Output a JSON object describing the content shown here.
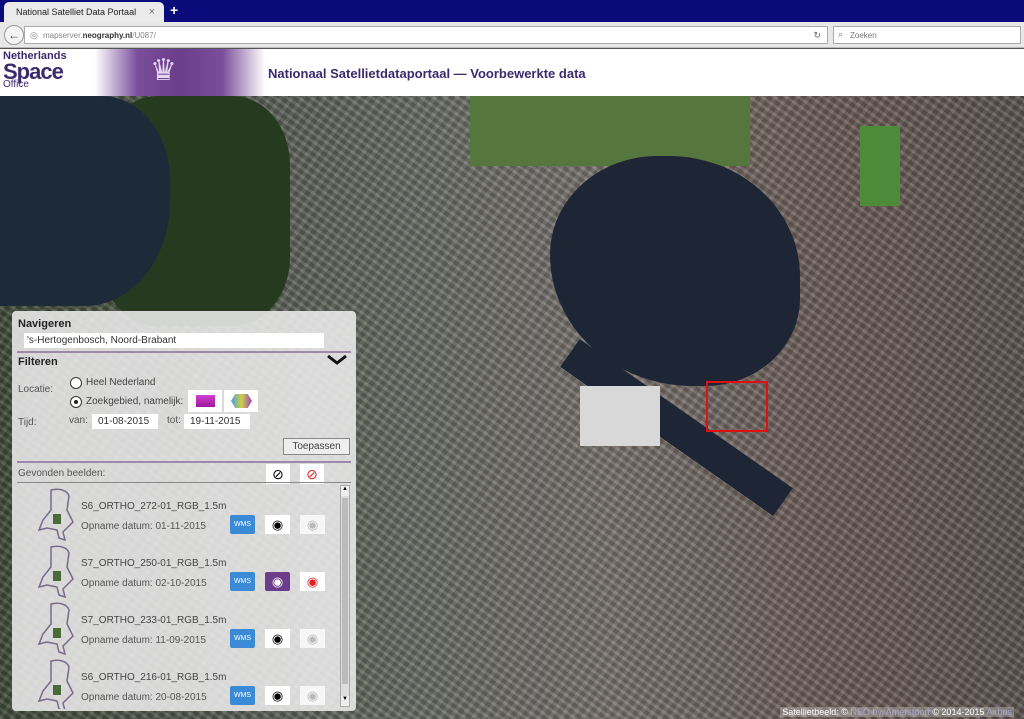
{
  "browser": {
    "tab_title": "National Satelliet Data Portaal",
    "tab_close": "×",
    "new_tab": "+",
    "url_prefix": "mapserver.",
    "url_domain": "neography.nl",
    "url_path": "/U087/",
    "search_placeholder": "Zoeken",
    "back": "←",
    "reload": "↻"
  },
  "header": {
    "logo_line1": "Netherlands",
    "logo_line2": "Space",
    "logo_line3": "Office",
    "crest": "♛",
    "title": "Nationaal Satellietdataportaal — Voorbewerkte data"
  },
  "map": {
    "attribution": "Satellietbeeld: ©",
    "attribution_link": "NEO bv, Amersfoort",
    "attribution_year": "© 2014-2015",
    "attribution_link2": "Airbus"
  },
  "panel": {
    "navigate_heading": "Navigeren",
    "navigate_value": "'s-Hertogenbosch, Noord-Brabant",
    "filter_heading": "Filteren",
    "location_label": "Locatie:",
    "option_all": "Heel Nederland",
    "option_area": "Zoekgebied, namelijk:",
    "selected_option": "Zoekgebied, namelijk:",
    "time_label": "Tijd:",
    "from_label": "van:",
    "from_value": "01-08-2015",
    "to_label": "tot:",
    "to_value": "19-11-2015",
    "apply_button": "Toepassen",
    "found_label": "Gevonden beelden:",
    "results": [
      {
        "name": "S6_ORTHO_272-01_RGB_1.5m",
        "date": "Opname datum: 01-11-2015",
        "wms": "WMS",
        "visible": false,
        "compare": false
      },
      {
        "name": "S7_ORTHO_250-01_RGB_1.5m",
        "date": "Opname datum: 02-10-2015",
        "wms": "WMS",
        "visible": true,
        "compare": true
      },
      {
        "name": "S7_ORTHO_233-01_RGB_1.5m",
        "date": "Opname datum: 11-09-2015",
        "wms": "WMS",
        "visible": false,
        "compare": false
      },
      {
        "name": "S6_ORTHO_216-01_RGB_1.5m",
        "date": "Opname datum: 20-08-2015",
        "wms": "WMS",
        "visible": false,
        "compare": false
      }
    ]
  },
  "colors": {
    "brand": "#3b2a6e",
    "accent": "#6b3d8a",
    "wms": "#3a8ad6",
    "selection": "#e01010"
  }
}
